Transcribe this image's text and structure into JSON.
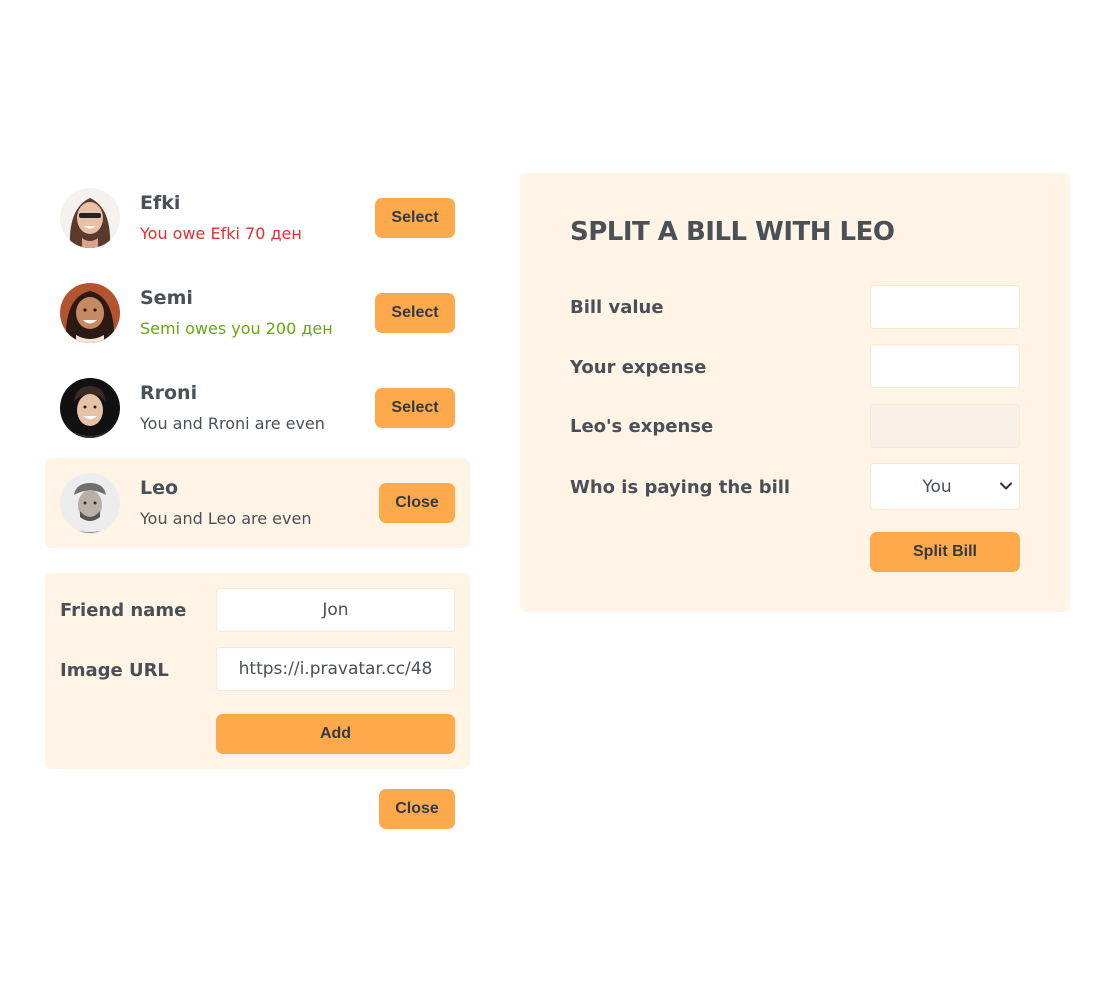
{
  "friends": [
    {
      "name": "Efki",
      "status": "You owe Efki 70 ден",
      "status_type": "owe",
      "button": "Select",
      "selected": false
    },
    {
      "name": "Semi",
      "status": "Semi owes you 200 ден",
      "status_type": "owed",
      "button": "Select",
      "selected": false
    },
    {
      "name": "Rroni",
      "status": "You and Rroni are even",
      "status_type": "even",
      "button": "Select",
      "selected": false
    },
    {
      "name": "Leo",
      "status": "You and Leo are even",
      "status_type": "even",
      "button": "Close",
      "selected": true
    }
  ],
  "add_form": {
    "name_label": "Friend name",
    "name_value": "Jon",
    "image_label": "Image URL",
    "image_value": "https://i.pravatar.cc/48",
    "add_label": "Add"
  },
  "close_form_label": "Close",
  "split": {
    "title": "SPLIT A BILL WITH LEO",
    "bill_label": "Bill value",
    "bill_value": "",
    "expense_label": "Your expense",
    "expense_value": "",
    "friend_expense_label": "Leo's expense",
    "friend_expense_value": "",
    "payer_label": "Who is paying the bill",
    "payer_value": "You",
    "submit_label": "Split Bill"
  },
  "colors": {
    "accent": "#ffa94d",
    "panel": "#fff4e6",
    "text": "#495057",
    "owe": "#e03131",
    "owed": "#66a80f"
  }
}
